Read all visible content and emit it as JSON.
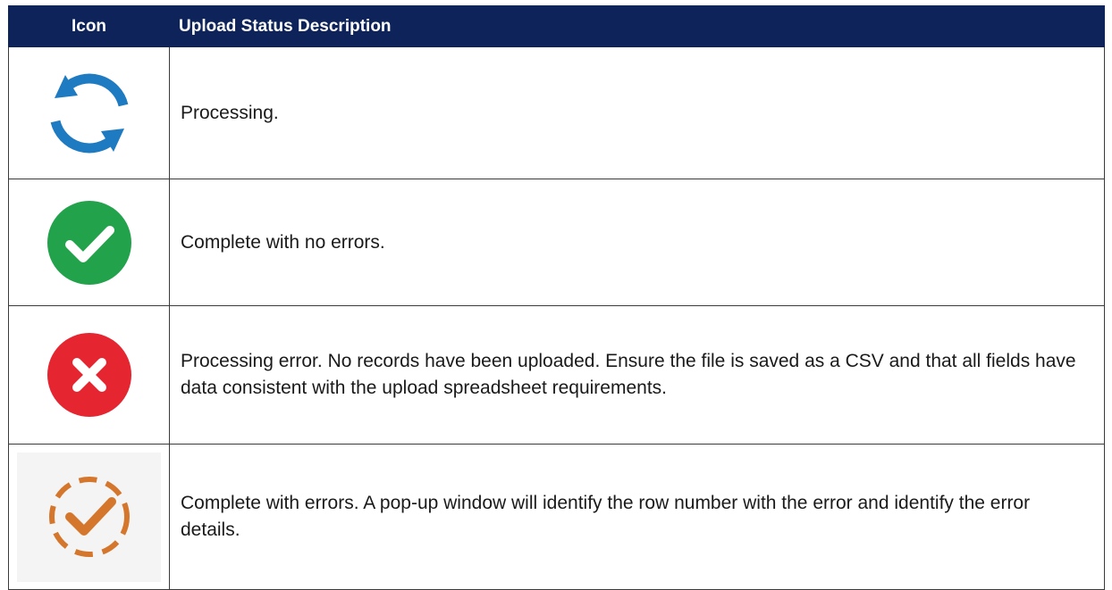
{
  "header": {
    "icon_col": "Icon",
    "description_col": "Upload Status Description"
  },
  "rows": [
    {
      "icon": "processing-icon",
      "description": "Processing."
    },
    {
      "icon": "complete-icon",
      "description": "Complete with no errors."
    },
    {
      "icon": "error-icon",
      "description": "Processing error. No records have been uploaded. Ensure the file is saved as a CSV and that all fields have data consistent with the upload spreadsheet requirements."
    },
    {
      "icon": "complete-with-errors-icon",
      "description": "Complete with errors. A pop-up window will identify the row number with the error and identify the error details."
    }
  ],
  "colors": {
    "header_bg": "#0d2359",
    "processing": "#1f7bc1",
    "complete": "#22a24a",
    "error": "#e52530",
    "warning": "#d4762c"
  }
}
